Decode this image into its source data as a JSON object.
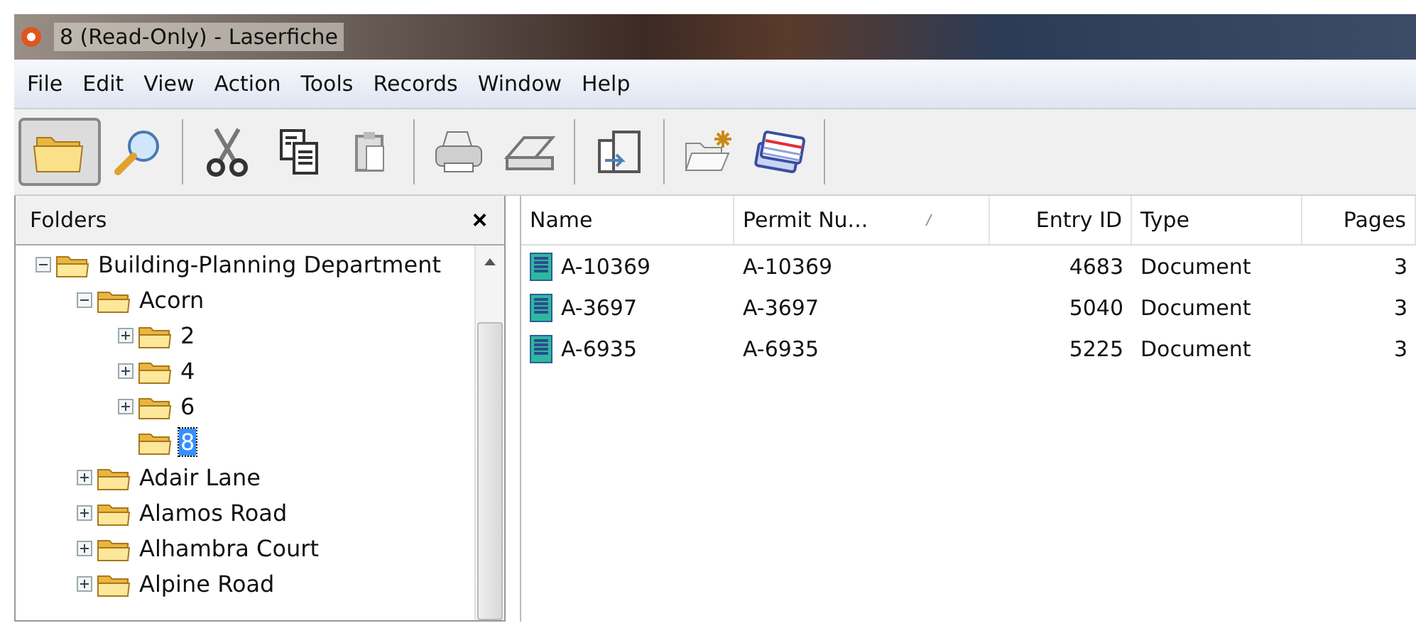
{
  "window": {
    "title": "8 (Read-Only) - Laserfiche"
  },
  "menu": [
    {
      "label": "File"
    },
    {
      "label": "Edit"
    },
    {
      "label": "View"
    },
    {
      "label": "Action"
    },
    {
      "label": "Tools"
    },
    {
      "label": "Records"
    },
    {
      "label": "Window"
    },
    {
      "label": "Help"
    }
  ],
  "toolbar": [
    {
      "kind": "folders",
      "selected": true
    },
    {
      "kind": "search",
      "selected": false
    },
    {
      "kind": "sep"
    },
    {
      "kind": "cut",
      "selected": false
    },
    {
      "kind": "copy",
      "selected": false
    },
    {
      "kind": "paste",
      "selected": false
    },
    {
      "kind": "sep"
    },
    {
      "kind": "print",
      "selected": false
    },
    {
      "kind": "scan",
      "selected": false
    },
    {
      "kind": "sep"
    },
    {
      "kind": "import",
      "selected": false
    },
    {
      "kind": "sep"
    },
    {
      "kind": "newfolder",
      "selected": false
    },
    {
      "kind": "cards",
      "selected": false
    },
    {
      "kind": "sep"
    }
  ],
  "folders_panel": {
    "title": "Folders",
    "close": "×",
    "tree": [
      {
        "label": "Building-Planning Department",
        "expanded": true,
        "selected": false,
        "children": [
          {
            "label": "Acorn",
            "expanded": true,
            "selected": false,
            "children": [
              {
                "label": "2",
                "expanded": false,
                "selected": false
              },
              {
                "label": "4",
                "expanded": false,
                "selected": false
              },
              {
                "label": "6",
                "expanded": false,
                "selected": false
              },
              {
                "label": "8",
                "selected": true
              }
            ]
          },
          {
            "label": "Adair Lane",
            "expanded": false,
            "selected": false
          },
          {
            "label": "Alamos Road",
            "expanded": false,
            "selected": false
          },
          {
            "label": "Alhambra Court",
            "expanded": false,
            "selected": false
          },
          {
            "label": "Alpine Road",
            "expanded": false,
            "selected": false
          }
        ]
      }
    ]
  },
  "table": {
    "columns": [
      {
        "label": "Name",
        "sorted": false
      },
      {
        "label": "Permit Nu...",
        "sorted": true
      },
      {
        "label": "Entry ID",
        "sorted": false
      },
      {
        "label": "Type",
        "sorted": false
      },
      {
        "label": "Pages",
        "sorted": false
      }
    ],
    "rows": [
      {
        "cells": [
          "A-10369",
          "A-10369",
          "4683",
          "Document",
          "3"
        ]
      },
      {
        "cells": [
          "A-3697",
          "A-3697",
          "5040",
          "Document",
          "3"
        ]
      },
      {
        "cells": [
          "A-6935",
          "A-6935",
          "5225",
          "Document",
          "3"
        ]
      }
    ]
  }
}
